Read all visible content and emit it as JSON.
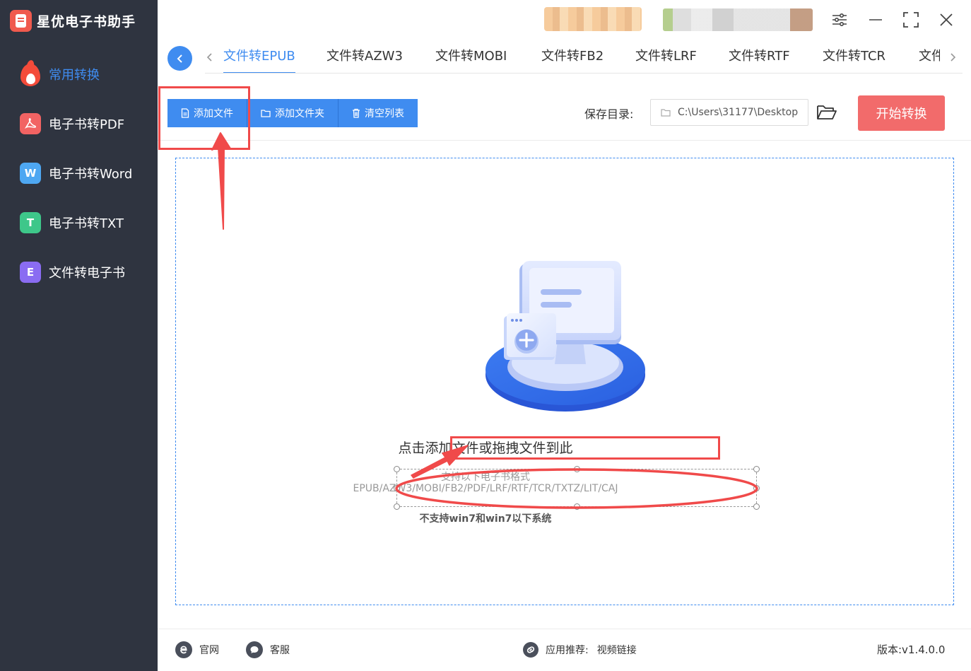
{
  "app": {
    "title": "星优电子书助手"
  },
  "sidebar": {
    "items": [
      {
        "label": "常用转换",
        "icon": "flame-icon",
        "active": true
      },
      {
        "label": "电子书转PDF",
        "icon": "pdf-icon",
        "color": "#f26363",
        "glyph": ""
      },
      {
        "label": "电子书转Word",
        "icon": "word-icon",
        "color": "#4ea7f2",
        "glyph": "W"
      },
      {
        "label": "电子书转TXT",
        "icon": "txt-icon",
        "color": "#3ec78a",
        "glyph": "T"
      },
      {
        "label": "文件转电子书",
        "icon": "ebook-icon",
        "color": "#8a6cf2",
        "glyph": "E"
      }
    ]
  },
  "tabs": [
    {
      "label": "文件转EPUB",
      "active": true
    },
    {
      "label": "文件转AZW3"
    },
    {
      "label": "文件转MOBI"
    },
    {
      "label": "文件转FB2"
    },
    {
      "label": "文件转LRF"
    },
    {
      "label": "文件转RTF"
    },
    {
      "label": "文件转TCR"
    },
    {
      "label": "文件转"
    }
  ],
  "toolbar": {
    "add_file": "添加文件",
    "add_folder": "添加文件夹",
    "clear_list": "清空列表",
    "save_dir_label": "保存目录:",
    "save_dir_value": "C:\\Users\\31177\\Desktop",
    "start": "开始转换"
  },
  "dropzone": {
    "main": "点击添加文件或拖拽文件到此",
    "sub1": "支持以下电子书格式",
    "sub2": "EPUB/AZW3/MOBI/FB2/PDF/LRF/RTF/TCR/TXTZ/LIT/CAJ",
    "note": "不支持win7和win7以下系统"
  },
  "footer": {
    "website": "官网",
    "support": "客服",
    "recommend": "应用推荐:",
    "video": "视频链接",
    "version": "版本:v1.4.0.0"
  },
  "colors": {
    "accent": "#3f8cf0",
    "start": "#f26b6b",
    "sidebar": "#2f3440",
    "annotation": "#f04a4a"
  }
}
